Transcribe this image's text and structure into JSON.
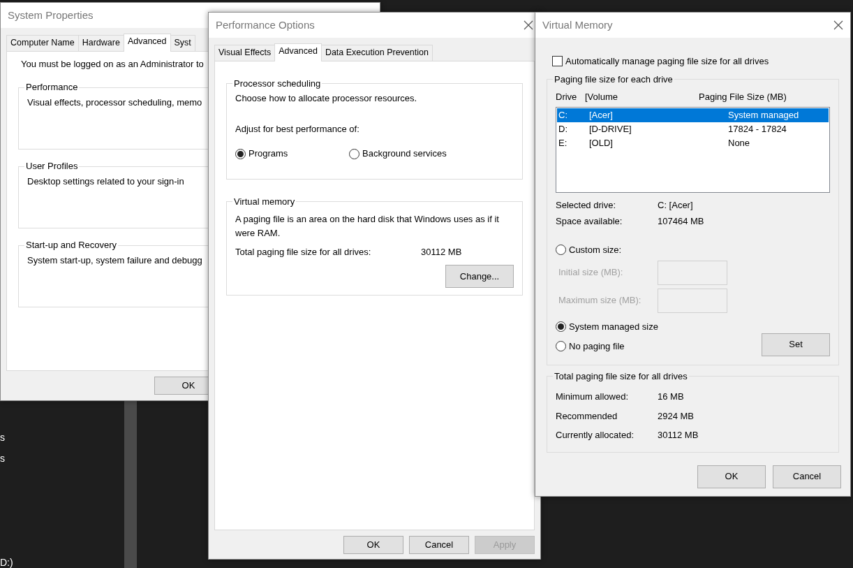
{
  "desktop_fragments": [
    {
      "text": "s"
    },
    {
      "text": "s"
    },
    {
      "text": "D:)"
    }
  ],
  "system_properties": {
    "title": "System Properties",
    "tabs": [
      {
        "label": "Computer Name",
        "selected": false
      },
      {
        "label": "Hardware",
        "selected": false
      },
      {
        "label": "Advanced",
        "selected": true
      },
      {
        "label": "Syst",
        "selected": false
      }
    ],
    "admin_note": "You must be logged on as an Administrator to",
    "groups": [
      {
        "title": "Performance",
        "text": "Visual effects, processor scheduling, memo"
      },
      {
        "title": "User Profiles",
        "text": "Desktop settings related to your sign-in"
      },
      {
        "title": "Start-up and Recovery",
        "text": "System start-up, system failure and debugg"
      }
    ],
    "buttons": [
      {
        "label": "OK",
        "disabled": false
      }
    ]
  },
  "performance_options": {
    "title": "Performance Options",
    "tabs": [
      {
        "label": "Visual Effects",
        "selected": false
      },
      {
        "label": "Advanced",
        "selected": true
      },
      {
        "label": "Data Execution Prevention",
        "selected": false
      }
    ],
    "processor_scheduling": {
      "title": "Processor scheduling",
      "text": "Choose how to allocate processor resources.",
      "adjust_label": "Adjust for best performance of:",
      "options": [
        {
          "label": "Programs",
          "selected": true
        },
        {
          "label": "Background services",
          "selected": false
        }
      ]
    },
    "virtual_memory": {
      "title": "Virtual memory",
      "text": "A paging file is an area on the hard disk that Windows uses as if it were RAM.",
      "total_label": "Total paging file size for all drives:",
      "total_value": "30112 MB",
      "button": "Change..."
    },
    "buttons": [
      {
        "label": "OK",
        "disabled": false
      },
      {
        "label": "Cancel",
        "disabled": false
      },
      {
        "label": "Apply",
        "disabled": true
      }
    ]
  },
  "virtual_memory": {
    "title": "Virtual Memory",
    "auto_manage": {
      "label": "Automatically manage paging file size for all drives",
      "checked": false
    },
    "per_drive": {
      "title": "Paging file size for each drive",
      "columns": [
        "Drive",
        "[Volume",
        "Paging File Size (MB)"
      ],
      "rows": [
        {
          "drive": "C:",
          "volume": "[Acer]",
          "size": "System managed",
          "selected": true
        },
        {
          "drive": "D:",
          "volume": "[D-DRIVE]",
          "size": "17824 - 17824",
          "selected": false
        },
        {
          "drive": "E:",
          "volume": "[OLD]",
          "size": "None",
          "selected": false
        }
      ],
      "info": [
        {
          "label": "Selected drive:",
          "value": "C:  [Acer]"
        },
        {
          "label": "Space available:",
          "value": "107464 MB"
        }
      ],
      "size_options": [
        {
          "kind": "radio",
          "label": "Custom size:",
          "selected": false
        },
        {
          "kind": "field",
          "label": "Initial size (MB):",
          "disabled": true
        },
        {
          "kind": "field",
          "label": "Maximum size (MB):",
          "disabled": true
        },
        {
          "kind": "radio",
          "label": "System managed size",
          "selected": true
        },
        {
          "kind": "radio",
          "label": "No paging file",
          "selected": false
        }
      ],
      "set_button": "Set"
    },
    "totals": {
      "title": "Total paging file size for all drives",
      "rows": [
        {
          "label": "Minimum allowed:",
          "value": "16 MB"
        },
        {
          "label": "Recommended",
          "value": "2924 MB"
        },
        {
          "label": "Currently allocated:",
          "value": "30112 MB"
        }
      ]
    },
    "buttons": [
      {
        "label": "OK",
        "disabled": false
      },
      {
        "label": "Cancel",
        "disabled": false
      }
    ]
  }
}
